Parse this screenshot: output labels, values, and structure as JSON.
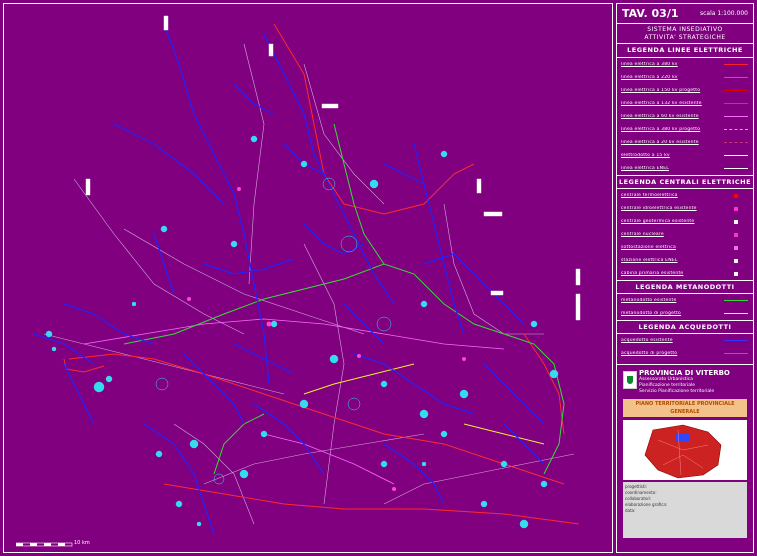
{
  "title": {
    "tav": "TAV. 03/1",
    "scale": "scala 1:100.000"
  },
  "subtitle": {
    "line1": "SISTEMA INSEDIATIVO",
    "line2": "ATTIVITA' STRATEGICHE"
  },
  "legend_lines": {
    "heading": "LEGENDA LINEE ELETTRICHE",
    "items": [
      {
        "label": "linea elettrica a 380 kv",
        "color": "#ff2222",
        "style": "solid"
      },
      {
        "label": "linea elettrica a 220 kv",
        "color": "#ff4444",
        "style": "solid"
      },
      {
        "label": "linea elettrica a 150 kv progetto",
        "color": "#dd0000",
        "style": "solid"
      },
      {
        "label": "linea elettrica a 132 kv esistente",
        "color": "#5555ff",
        "style": "solid"
      },
      {
        "label": "linea elettrica a 60 kv esistente",
        "color": "#ff66ff",
        "style": "solid"
      },
      {
        "label": "linea elettrica a 380 kv progetto",
        "color": "#ff88ff",
        "style": "dashed"
      },
      {
        "label": "linea elettrica a 20 kv esistente",
        "color": "#cc3377",
        "style": "dashed"
      },
      {
        "label": "elettrodotto a 15 kv",
        "color": "#ffffff",
        "style": "solid"
      },
      {
        "label": "linea elettrica ENEL",
        "color": "#ffffff",
        "style": "solid"
      }
    ]
  },
  "legend_centrals": {
    "heading": "LEGENDA CENTRALI ELETTRICHE",
    "items": [
      {
        "label": "centrale termoelettrica",
        "color": "#ff0000"
      },
      {
        "label": "centrale idroelettrica esistente",
        "color": "#ff33cc"
      },
      {
        "label": "centrale geotermica esistente",
        "color": "#ffffff"
      },
      {
        "label": "centrale nucleare",
        "color": "#ff33cc"
      },
      {
        "label": "sottostazione elettrica",
        "color": "#ff66ff"
      },
      {
        "label": "stazione elettrica ENEL",
        "color": "#ffffff"
      },
      {
        "label": "cabina primaria esistente",
        "color": "#ffffff"
      }
    ]
  },
  "legend_gas": {
    "heading": "LEGENDA METANODOTTI",
    "items": [
      {
        "label": "metanodotto esistente",
        "color": "#33dd33"
      },
      {
        "label": "metanodotto di progetto",
        "color": "#ffff33"
      }
    ]
  },
  "legend_water": {
    "heading": "LEGENDA ACQUEDOTTI",
    "items": [
      {
        "label": "acquedotto esistente",
        "color": "#3333ff"
      },
      {
        "label": "acquedotto di progetto",
        "color": "#6666ff"
      }
    ]
  },
  "province": {
    "name": "PROVINCIA DI VITERBO",
    "line1": "Assessorato Urbanistica",
    "line2": "Pianificazione territoriale",
    "line3": "Servizio Pianificazione territoriale",
    "banner": "PIANO TERRITORIALE PROVINCIALE GENERALE",
    "data_lines": [
      "progettisti:",
      "coordinamento:",
      "collaboratori:",
      "elaborazione grafica:",
      "data:"
    ]
  },
  "scalebar": {
    "label": "10 km"
  },
  "colors": {
    "background": "#800080",
    "water_network": "#2222ff",
    "lakes": "#33ddee",
    "high_voltage": "#ff2222",
    "gas_pipeline": "#33dd33",
    "roads": "#ffffff"
  }
}
